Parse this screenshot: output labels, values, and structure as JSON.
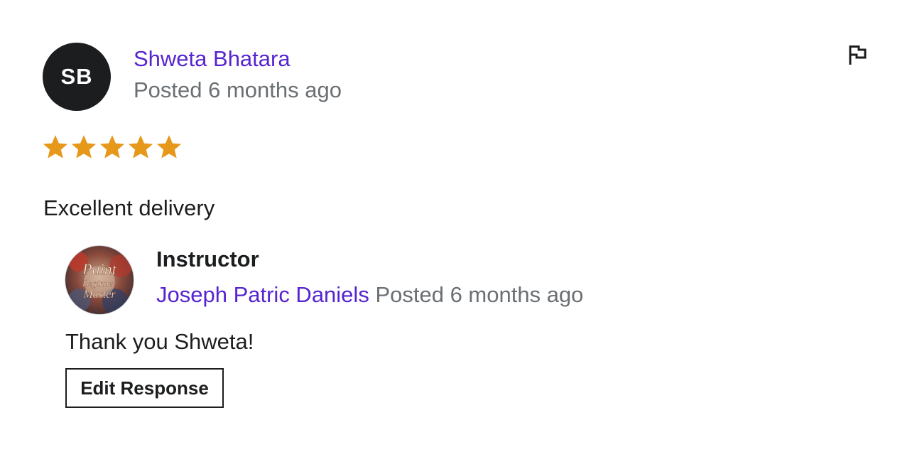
{
  "review": {
    "avatar_initials": "SB",
    "reviewer_name": "Shweta Bhatara",
    "posted": "Posted 6 months ago",
    "rating": 5,
    "rating_max": 5,
    "comment": "Excellent delivery",
    "flag_icon": "flag-icon"
  },
  "instructor_response": {
    "label": "Instructor",
    "avatar_text": [
      "Paint",
      "Beginner",
      "Master"
    ],
    "name": "Joseph Patric Daniels",
    "posted": "Posted 6 months ago",
    "response_text": "Thank you Shweta!",
    "edit_button_label": "Edit Response"
  },
  "colors": {
    "link": "#5624d0",
    "muted": "#6a6f73",
    "text": "#1c1d1f",
    "star": "#e59819",
    "avatar_bg": "#1c1d1f"
  }
}
